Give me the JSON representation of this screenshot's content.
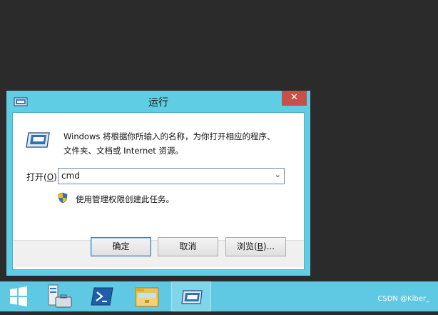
{
  "dialog": {
    "title": "运行",
    "close_symbol": "✕",
    "description_line1": "Windows 将根据你所输入的名称，为你打开相应的程序、",
    "description_line2": "文件夹、文档或 Internet 资源。",
    "open_label_prefix": "打开(",
    "open_label_hotkey": "O",
    "open_label_suffix": "):",
    "command_value": "cmd",
    "combo_arrow": "⌄",
    "uac_text": "使用管理权限创建此任务。",
    "buttons": {
      "ok": "确定",
      "cancel": "取消",
      "browse_prefix": "浏览(",
      "browse_hotkey": "B",
      "browse_suffix": ")..."
    },
    "icons": {
      "title": "run-icon",
      "main": "run-icon",
      "uac": "uac-shield-icon"
    }
  },
  "taskbar": {
    "items": [
      {
        "name": "start",
        "icon": "windows-start-icon"
      },
      {
        "name": "server-manager",
        "icon": "server-manager-icon"
      },
      {
        "name": "powershell",
        "icon": "powershell-icon"
      },
      {
        "name": "file-explorer",
        "icon": "folder-icon"
      },
      {
        "name": "run",
        "icon": "run-icon",
        "active": true
      }
    ]
  },
  "watermark": "CSDN @Kiber_",
  "colors": {
    "desktop": "#2b2b2b",
    "window_frame": "#5fcde4",
    "close_button": "#c7504b",
    "taskbar": "#5fc8e2"
  }
}
